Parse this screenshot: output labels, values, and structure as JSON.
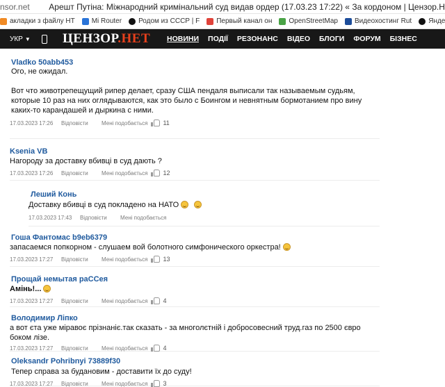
{
  "browser": {
    "url": "nsor.net",
    "title": "Арешт Путіна: Міжнародний кримінальний суд видав ордер (17.03.23 17:22) « За кордоном | Цензор.НЕТ"
  },
  "bookmarks": [
    {
      "label": "акладки з файлу HT",
      "icon": "folder-icon",
      "color": "ic-orange"
    },
    {
      "label": "Mi Router",
      "icon": "mi-router-icon",
      "color": "ic-blue"
    },
    {
      "label": "Родом из СССР | F",
      "icon": "circle-icon",
      "color": "ic-black"
    },
    {
      "label": "Первый канал он",
      "icon": "channel-icon",
      "color": "ic-red"
    },
    {
      "label": "OpenStreetMap",
      "icon": "map-icon",
      "color": "ic-green"
    },
    {
      "label": "Видеохостинг Rut",
      "icon": "video-icon",
      "color": "ic-darkblue"
    },
    {
      "label": "Яндекс.Дзен — пл",
      "icon": "zen-icon",
      "color": "ic-black"
    }
  ],
  "nav": {
    "lang": "УКР",
    "logo_main": "ЦЕНЗОР",
    "logo_dot": ".",
    "logo_net": "НЕТ",
    "links": [
      "НОВИНИ",
      "ПОДІЇ",
      "РЕЗОНАНС",
      "ВІДЕО",
      "БЛОГИ",
      "ФОРУМ",
      "БІЗНЕС"
    ]
  },
  "labels": {
    "reply": "Відповісти",
    "like": "Мені подобається"
  },
  "comments": [
    {
      "author": "Vladko 50abb453",
      "lines": [
        "Ого, не ожидал.",
        "",
        "Вот что животрепещущий рипер делает, сразу США пендаля выписали так называемым судьям,",
        "которые 10 раз на них оглядываются, как это было с Боингом и невнятным бормотанием про вину",
        "каких-то карандашей и дыркина с ними."
      ],
      "date": "17.03.2023 17:26",
      "likes": "11"
    },
    {
      "author": "Ksenia VB",
      "lines": [
        "Нагороду за доставку вбивці в суд дають ?"
      ],
      "date": "17.03.2023 17:26",
      "likes": "12"
    },
    {
      "author": "Леший Конь",
      "lines": [
        "Доставку вбивці в суд покладено на НАТО"
      ],
      "date": "17.03.2023 17:43",
      "likes": ""
    },
    {
      "author": "Гоша Фантомас b9eb6379",
      "lines": [
        "запасаемся попкорном - слушаем вой болотного симфонического оркестра!"
      ],
      "date": "17.03.2023 17:27",
      "likes": "13"
    },
    {
      "author": "Прощай немытая раССея",
      "lines": [
        "Амінь!..."
      ],
      "date": "17.03.2023 17:27",
      "likes": "4"
    },
    {
      "author": "Володимир Ліпко",
      "lines": [
        "а вот єта уже міравоє прізнаніє.так сказать - за многолєтній і добросовесний труд.газ по 2500 євро",
        "боком лізе."
      ],
      "date": "17.03.2023 17:27",
      "likes": "4"
    },
    {
      "author": "Oleksandr Pohribnyi 73889f30",
      "lines": [
        "Тепер справа за будановим - доставити їх до суду!"
      ],
      "date": "17.03.2023 17:27",
      "likes": "3"
    }
  ]
}
